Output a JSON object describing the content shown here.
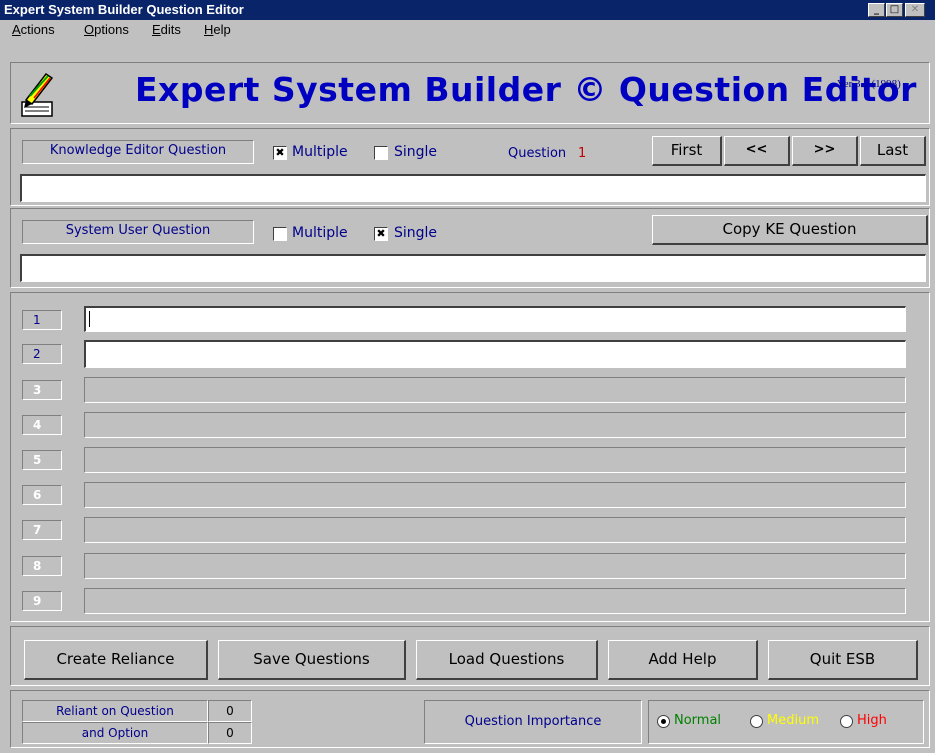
{
  "window": {
    "title": "Expert System Builder Question Editor"
  },
  "menu": [
    "Actions",
    "Options",
    "Edits",
    "Help"
  ],
  "header": {
    "title": "Expert System Builder © Question Editor",
    "version": "Ver 3.1 (1998)",
    "logo_icon": "pencil-notepad-icon"
  },
  "ke_section": {
    "label": "Knowledge Editor Question",
    "multiple_label": "Multiple",
    "multiple_checked": true,
    "single_label": "Single",
    "single_checked": false,
    "question_label": "Question",
    "question_number": "1",
    "nav": {
      "first": "First",
      "prev": "<<",
      "next": ">>",
      "last": "Last"
    },
    "question_text": ""
  },
  "user_section": {
    "label": "System User Question",
    "multiple_label": "Multiple",
    "multiple_checked": false,
    "single_label": "Single",
    "single_checked": true,
    "copy_button": "Copy KE Question",
    "question_text": ""
  },
  "options": [
    {
      "number": "1",
      "value": "",
      "enabled": true
    },
    {
      "number": "2",
      "value": "",
      "enabled": true
    },
    {
      "number": "3",
      "value": "",
      "enabled": false
    },
    {
      "number": "4",
      "value": "",
      "enabled": false
    },
    {
      "number": "5",
      "value": "",
      "enabled": false
    },
    {
      "number": "6",
      "value": "",
      "enabled": false
    },
    {
      "number": "7",
      "value": "",
      "enabled": false
    },
    {
      "number": "8",
      "value": "",
      "enabled": false
    },
    {
      "number": "9",
      "value": "",
      "enabled": false
    }
  ],
  "actions": {
    "create_reliance": "Create Reliance",
    "save": "Save Questions",
    "load": "Load Questions",
    "add_help": "Add Help",
    "quit": "Quit ESB"
  },
  "status": {
    "reliant_question_label": "Reliant on Question",
    "reliant_question_value": "0",
    "option_label": "and Option",
    "option_value": "0",
    "importance_label": "Question Importance",
    "importance": [
      {
        "label": "Normal",
        "color": "#008000",
        "selected": true
      },
      {
        "label": "Medium",
        "color": "#ffff00",
        "selected": false
      },
      {
        "label": "High",
        "color": "#ff0000",
        "selected": false
      }
    ]
  }
}
